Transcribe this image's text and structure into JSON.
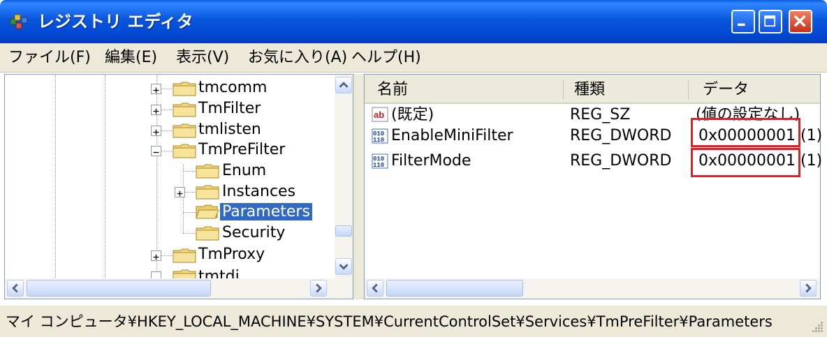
{
  "window": {
    "title": "レジストリ エディタ",
    "app_icon": "registry-editor-icon",
    "controls": [
      "minimize-icon",
      "maximize-icon",
      "close-icon"
    ]
  },
  "menu": [
    {
      "label": "ファイル(F)"
    },
    {
      "label": "編集(E)"
    },
    {
      "label": "表示(V)"
    },
    {
      "label": "お気に入り(A)"
    },
    {
      "label": "ヘルプ(H)"
    }
  ],
  "tree": {
    "items": [
      {
        "label": "tmcomm",
        "expander": "plus"
      },
      {
        "label": "TmFilter",
        "expander": "plus"
      },
      {
        "label": "tmlisten",
        "expander": "plus"
      },
      {
        "label": "TmPreFilter",
        "expander": "minus"
      },
      {
        "label": "Enum",
        "expander": "none"
      },
      {
        "label": "Instances",
        "expander": "plus"
      },
      {
        "label": "Parameters",
        "expander": "none",
        "selected": true,
        "open_folder": true
      },
      {
        "label": "Security",
        "expander": "none"
      },
      {
        "label": "TmProxy",
        "expander": "plus"
      },
      {
        "label": "tmtdi",
        "expander": "plus"
      }
    ]
  },
  "list": {
    "columns": [
      "名前",
      "種類",
      "データ"
    ],
    "rows": [
      {
        "icon": "string-value-icon",
        "name": "(既定)",
        "type": "REG_SZ",
        "data": "(値の設定なし)"
      },
      {
        "icon": "binary-value-icon",
        "name": "EnableMiniFilter",
        "type": "REG_DWORD",
        "data": "0x00000001 (1)",
        "highlighted": true
      },
      {
        "icon": "binary-value-icon",
        "name": "FilterMode",
        "type": "REG_DWORD",
        "data": "0x00000001 (1)",
        "highlighted": true
      }
    ]
  },
  "status": {
    "path": "マイ コンピュータ¥HKEY_LOCAL_MACHINE¥SYSTEM¥CurrentControlSet¥Services¥TmPreFilter¥Parameters"
  },
  "colors": {
    "titlebar": "#0a56dd",
    "selection": "#316ac5",
    "highlight_box": "#e41e26",
    "chrome": "#ece9d8"
  }
}
